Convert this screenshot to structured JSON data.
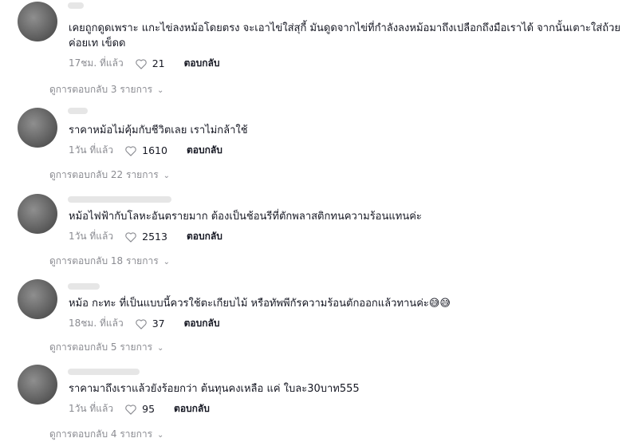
{
  "comments": [
    {
      "text": "เคยถูกดูดเพราะ แกะไข่ลงหม้อโดยตรง จะเอาไข่ใส่สุกี้ มันดูดจากไข่ที่กำลังลงหม้อมาถึงเปลือกถึงมือเราได้ จากนั้นเตาะใส่ถ้วยค่อยเท เข็ดด",
      "time": "17ชม. ที่แล้ว",
      "likes": "21",
      "reply": "ตอบกลับ",
      "view_replies": "ดูการตอบกลับ 3 รายการ"
    },
    {
      "text": "ราคาหม้อไม่คุ้มกับชีวิตเลย เราไม่กล้าใช้",
      "time": "1วัน ที่แล้ว",
      "likes": "1610",
      "reply": "ตอบกลับ",
      "view_replies": "ดูการตอบกลับ 22 รายการ"
    },
    {
      "text": "หม้อไฟฟ้ากับโลหะอันตรายมาก ต้องเป็นช้อนรีที่ตักพลาสติกทนความร้อนแทนค่ะ",
      "time": "1วัน ที่แล้ว",
      "likes": "2513",
      "reply": "ตอบกลับ",
      "view_replies": "ดูการตอบกลับ 18 รายการ"
    },
    {
      "text": "หม้อ กะทะ ที่เป็นแบบนี้ควรใช้ตะเกียบไม้ หรือทัพพีกัรความร้อนตักออกแล้วทานค่ะ😅😅",
      "time": "18ชม. ที่แล้ว",
      "likes": "37",
      "reply": "ตอบกลับ",
      "view_replies": "ดูการตอบกลับ 5 รายการ"
    },
    {
      "text": "ราคามาถึงเราแล้วยังร้อยกว่า ต้นทุนคงเหลือ แค่ ใบละ30บาท555",
      "time": "1วัน ที่แล้ว",
      "likes": "95",
      "reply": "ตอบกลับ",
      "view_replies": "ดูการตอบกลับ 4 รายการ"
    }
  ],
  "icons": {
    "like": "heart-outline-icon",
    "expand": "chevron-down-icon"
  }
}
